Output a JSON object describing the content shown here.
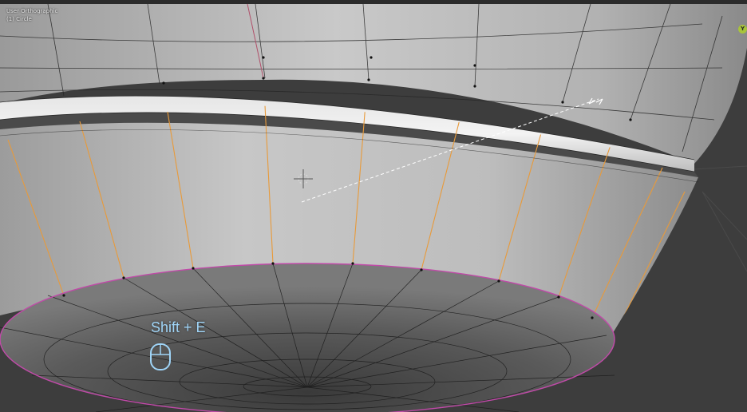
{
  "viewport": {
    "view_mode": "User Orthographic",
    "object_name": "(1) Circle",
    "gizmo_axis": "Y",
    "shortcut_key": "Shift + E",
    "shortcut_icon": "mouse-icon"
  },
  "colors": {
    "background": "#3d3d3d",
    "mesh_surface": "#b8b8b8",
    "selected_edge": "#e89a3a",
    "seam_edge": "#c04aa8",
    "shortcut_text": "#9fd4f7",
    "gizmo_y": "#a9c43a"
  }
}
